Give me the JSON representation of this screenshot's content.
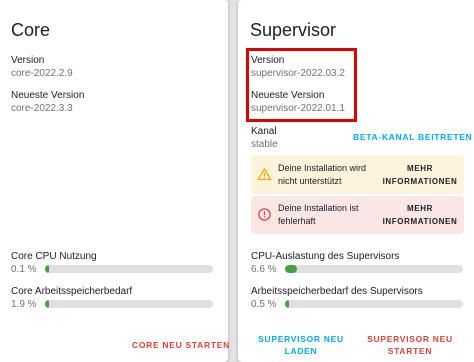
{
  "core": {
    "title": "Core",
    "version_label": "Version",
    "version_value": "core-2022.2.9",
    "latest_label": "Neueste Version",
    "latest_value": "core-2022.3.3",
    "cpu_label": "Core CPU Nutzung",
    "cpu_value": "0.1 %",
    "cpu_fraction": 0.001,
    "mem_label": "Core Arbeitsspeicherbedarf",
    "mem_value": "1.9 %",
    "mem_fraction": 0.019,
    "restart_button": "CORE NEU STARTEN"
  },
  "supervisor": {
    "title": "Supervisor",
    "version_label": "Version",
    "version_value": "supervisor-2022.03.2",
    "latest_label": "Neueste Version",
    "latest_value": "supervisor-2022.01.1",
    "channel_label": "Kanal",
    "channel_value": "stable",
    "beta_button": "BETA-KANAL BEITRETEN",
    "warning": {
      "icon": "warning-triangle-icon",
      "message": "Deine Installation wird nicht unterstützt",
      "action": "MEHR INFORMATIONEN"
    },
    "error": {
      "icon": "error-circle-icon",
      "message": "Deine Installation ist fehlerhaft",
      "action": "MEHR INFORMATIONEN"
    },
    "cpu_label": "CPU-Auslastung des Supervisors",
    "cpu_value": "6.6 %",
    "cpu_fraction": 0.066,
    "mem_label": "Arbeitsspeicherbedarf des Supervisors",
    "mem_value": "0.5 %",
    "mem_fraction": 0.005,
    "reload_button": "SUPERVISOR NEU LADEN",
    "restart_button": "SUPERVISOR NEU STARTEN"
  },
  "colors": {
    "progress_fill": "#43a047",
    "progress_track": "#e0e0e0",
    "danger_button": "#db4437",
    "primary_button": "#03a9f4",
    "warning_bg": "#fdf3dd",
    "warning_icon": "#ffa600",
    "error_bg": "#fbe6e6",
    "error_icon": "#db4437",
    "highlight_box": "#e00000"
  }
}
